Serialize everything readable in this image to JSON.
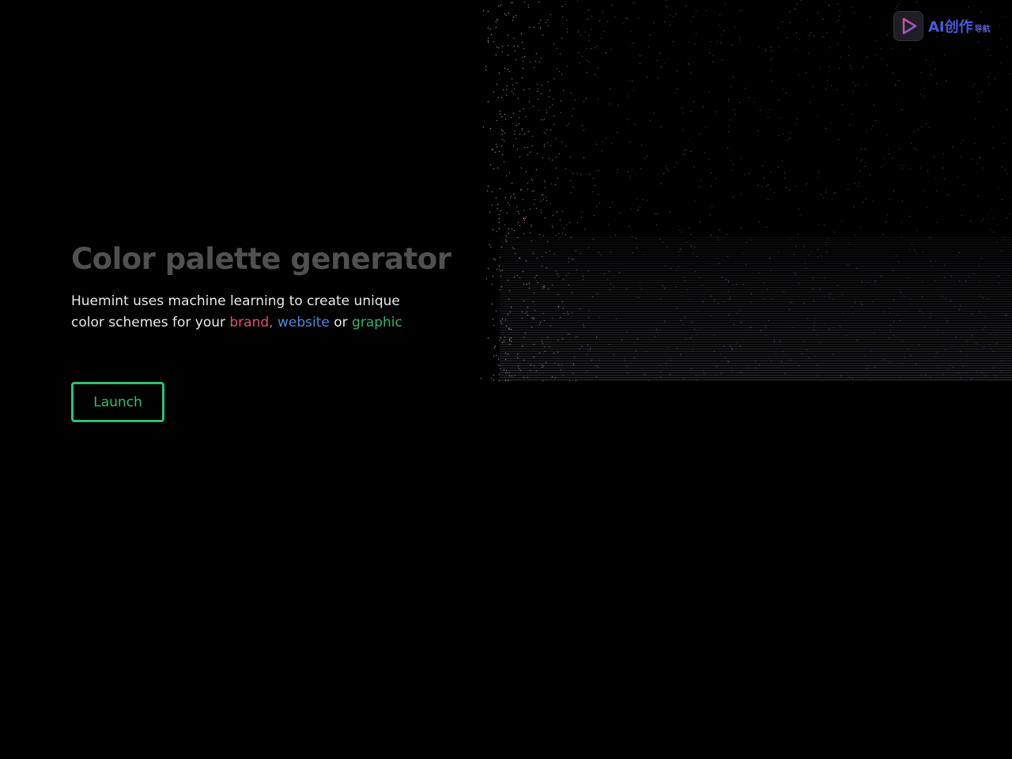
{
  "hero": {
    "title": "Color palette generator",
    "subtitle_prefix": "Huemint uses machine learning to create unique color schemes for your ",
    "word_brand": "brand,",
    "word_website": "website",
    "word_or": " or ",
    "word_graphic": "graphic"
  },
  "actions": {
    "launch_label": "Launch"
  },
  "badge": {
    "logo_glyph": "创",
    "text": "AI创作",
    "sub": "导航"
  },
  "colors": {
    "background": "#000000",
    "title": "#505050",
    "brand": "#e04f6f",
    "website": "#4a88dc",
    "graphic": "#35b36b",
    "launch_accent": "#2fbf74"
  }
}
